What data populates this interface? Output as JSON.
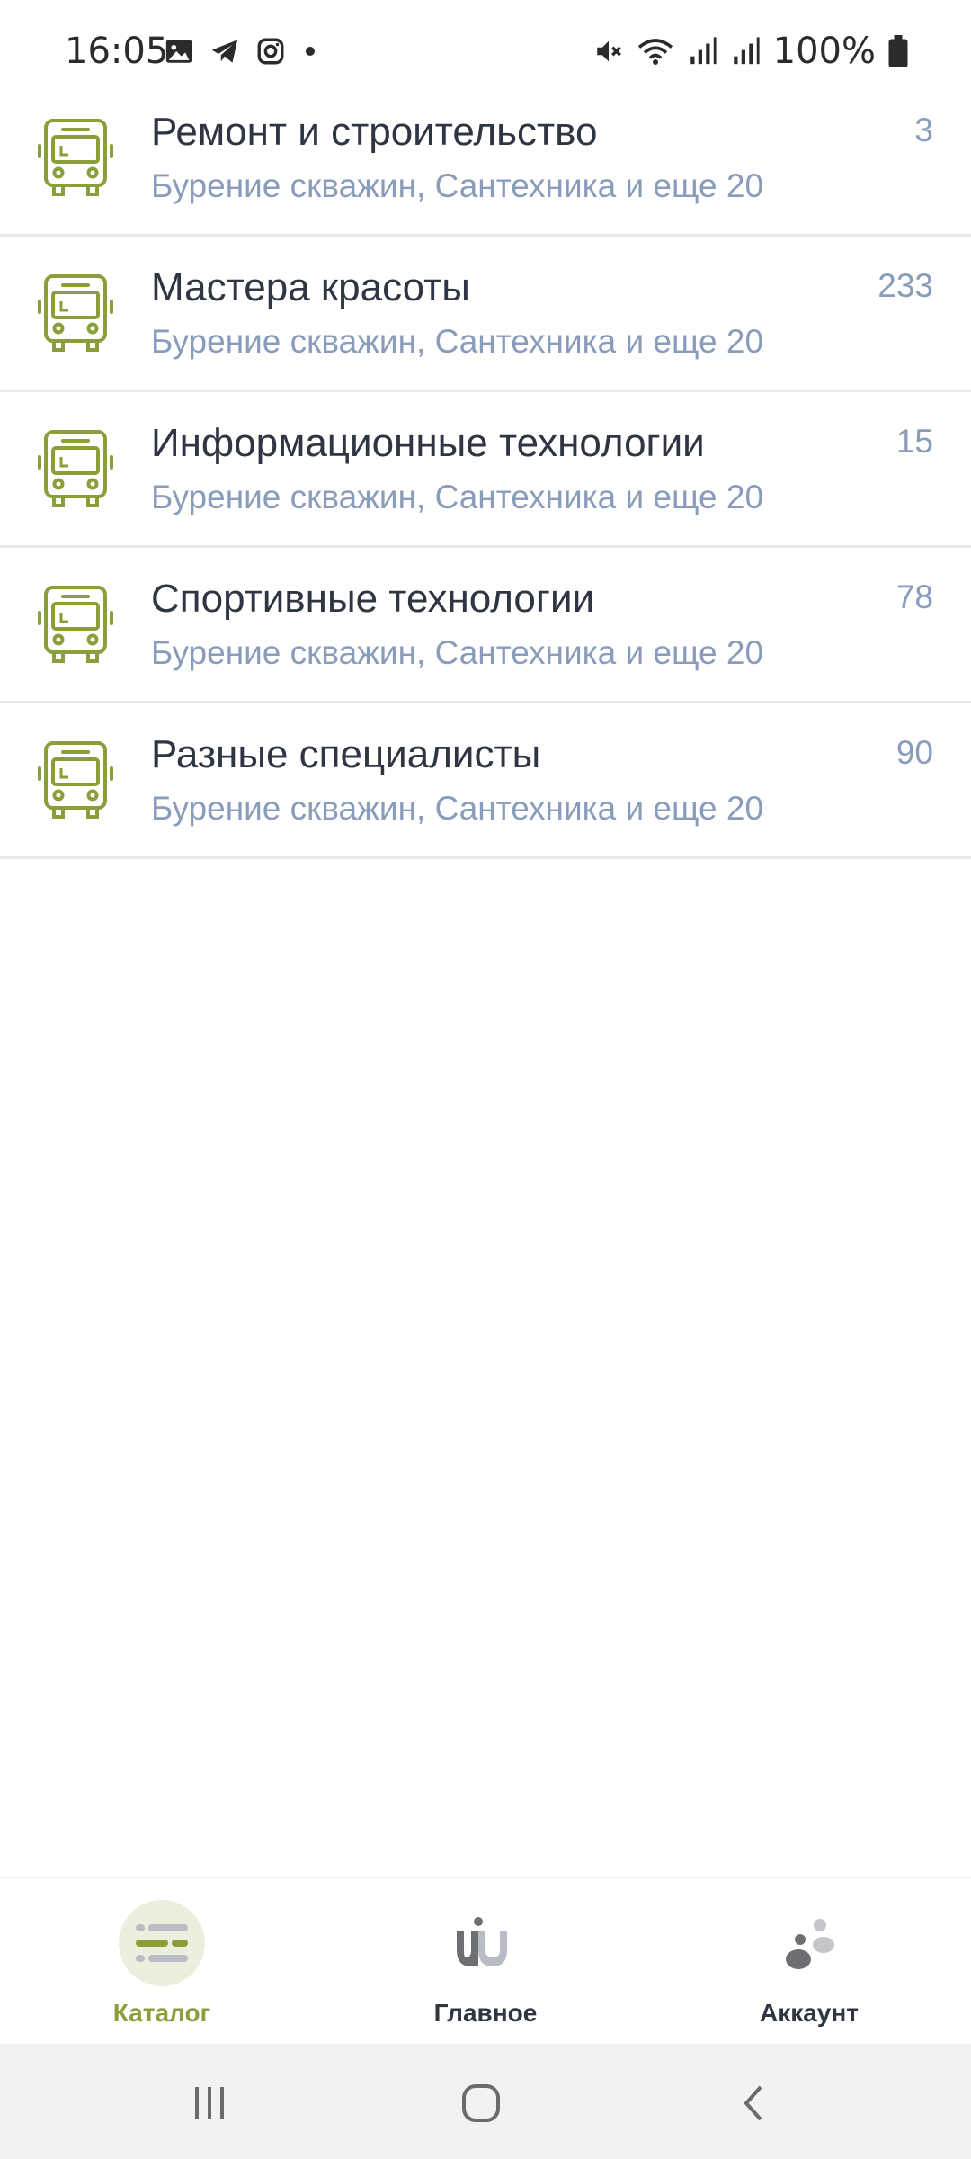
{
  "status_bar": {
    "time": "16:05",
    "battery": "100%",
    "left_icons": [
      "gallery-icon",
      "telegram-icon",
      "instagram-icon",
      "dot-icon"
    ],
    "right_icons": [
      "mute-icon",
      "wifi-icon",
      "signal-icon",
      "signal-icon",
      "battery-icon"
    ]
  },
  "accent_color": "#8a9f3a",
  "categories": [
    {
      "title": "Ремонт и строительство",
      "subtitle": "Бурение скважин, Сантехника и еще 20",
      "count": "3"
    },
    {
      "title": "Мастера красоты",
      "subtitle": "Бурение скважин, Сантехника и еще 20",
      "count": "233"
    },
    {
      "title": "Информационные технологии",
      "subtitle": "Бурение скважин, Сантехника и еще 20",
      "count": "15"
    },
    {
      "title": "Спортивные технологии",
      "subtitle": "Бурение скважин, Сантехника и еще 20",
      "count": "78"
    },
    {
      "title": "Разные специалисты",
      "subtitle": "Бурение скважин, Сантехника и еще 20",
      "count": "90"
    }
  ],
  "bottom_nav": {
    "catalog": "Каталог",
    "main": "Главное",
    "account": "Аккаунт",
    "active": "catalog"
  }
}
